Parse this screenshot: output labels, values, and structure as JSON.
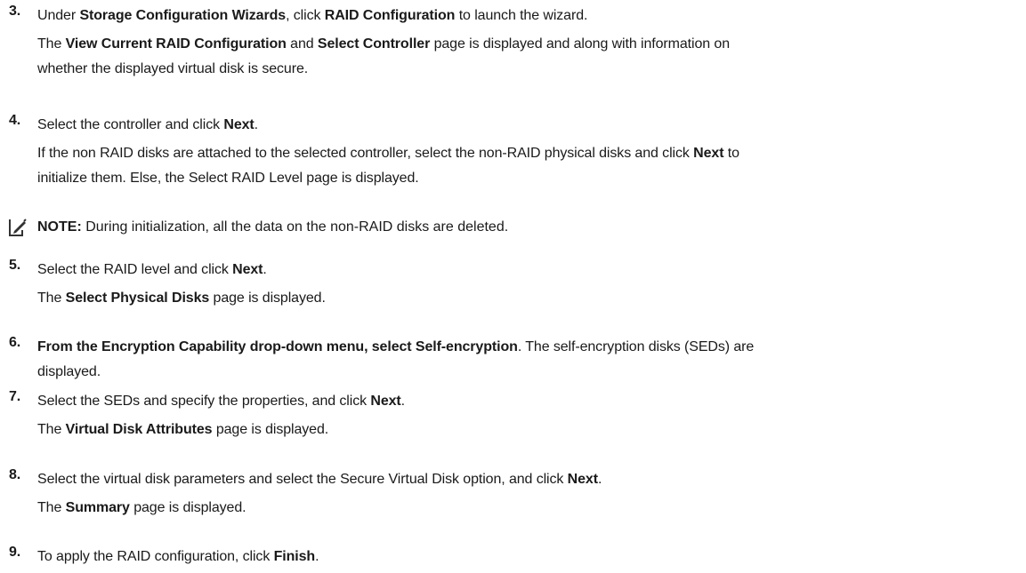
{
  "steps": {
    "s3": {
      "number": "3.",
      "l1": [
        "Under ",
        "Storage Configuration Wizards",
        ", click ",
        "RAID Configuration",
        " to launch the wizard."
      ],
      "l2": [
        "The ",
        "View Current RAID Configuration",
        " and ",
        "Select Controller",
        " page is displayed and along with information on"
      ],
      "l3": "whether the displayed virtual disk is secure."
    },
    "s4": {
      "number": "4.",
      "l1": [
        "Select the controller and click ",
        "Next",
        "."
      ],
      "l2": [
        "If the non RAID disks are attached to the selected controller, select the non-RAID physical disks and click ",
        "Next",
        " to"
      ],
      "l3": "initialize them. Else, the Select RAID Level page is displayed."
    },
    "note": {
      "label": "NOTE:",
      "text": " During initialization, all the data on the non-RAID disks are deleted.",
      "icon": "pencil-note-icon"
    },
    "s5": {
      "number": "5.",
      "l1": [
        "Select the RAID level and click ",
        "Next",
        "."
      ],
      "l2": [
        "The ",
        "Select Physical Disks",
        " page is displayed."
      ]
    },
    "s6": {
      "number": "6.",
      "l1": [
        "From the Encryption Capability drop-down menu, select Self-encryption",
        ". The self-encryption disks (SEDs) are"
      ],
      "l2": "displayed."
    },
    "s7": {
      "number": "7.",
      "l1": [
        "Select the SEDs and specify the properties, and click ",
        "Next",
        "."
      ],
      "l2": [
        "The ",
        "Virtual Disk Attributes",
        " page is displayed."
      ]
    },
    "s8": {
      "number": "8.",
      "l1": [
        "Select the virtual disk parameters and select the Secure Virtual Disk option, and click ",
        "Next",
        "."
      ],
      "l2": [
        "The ",
        "Summary",
        " page is displayed."
      ]
    },
    "s9": {
      "number": "9.",
      "l1": [
        "To apply the RAID configuration, click ",
        "Finish",
        "."
      ]
    }
  }
}
